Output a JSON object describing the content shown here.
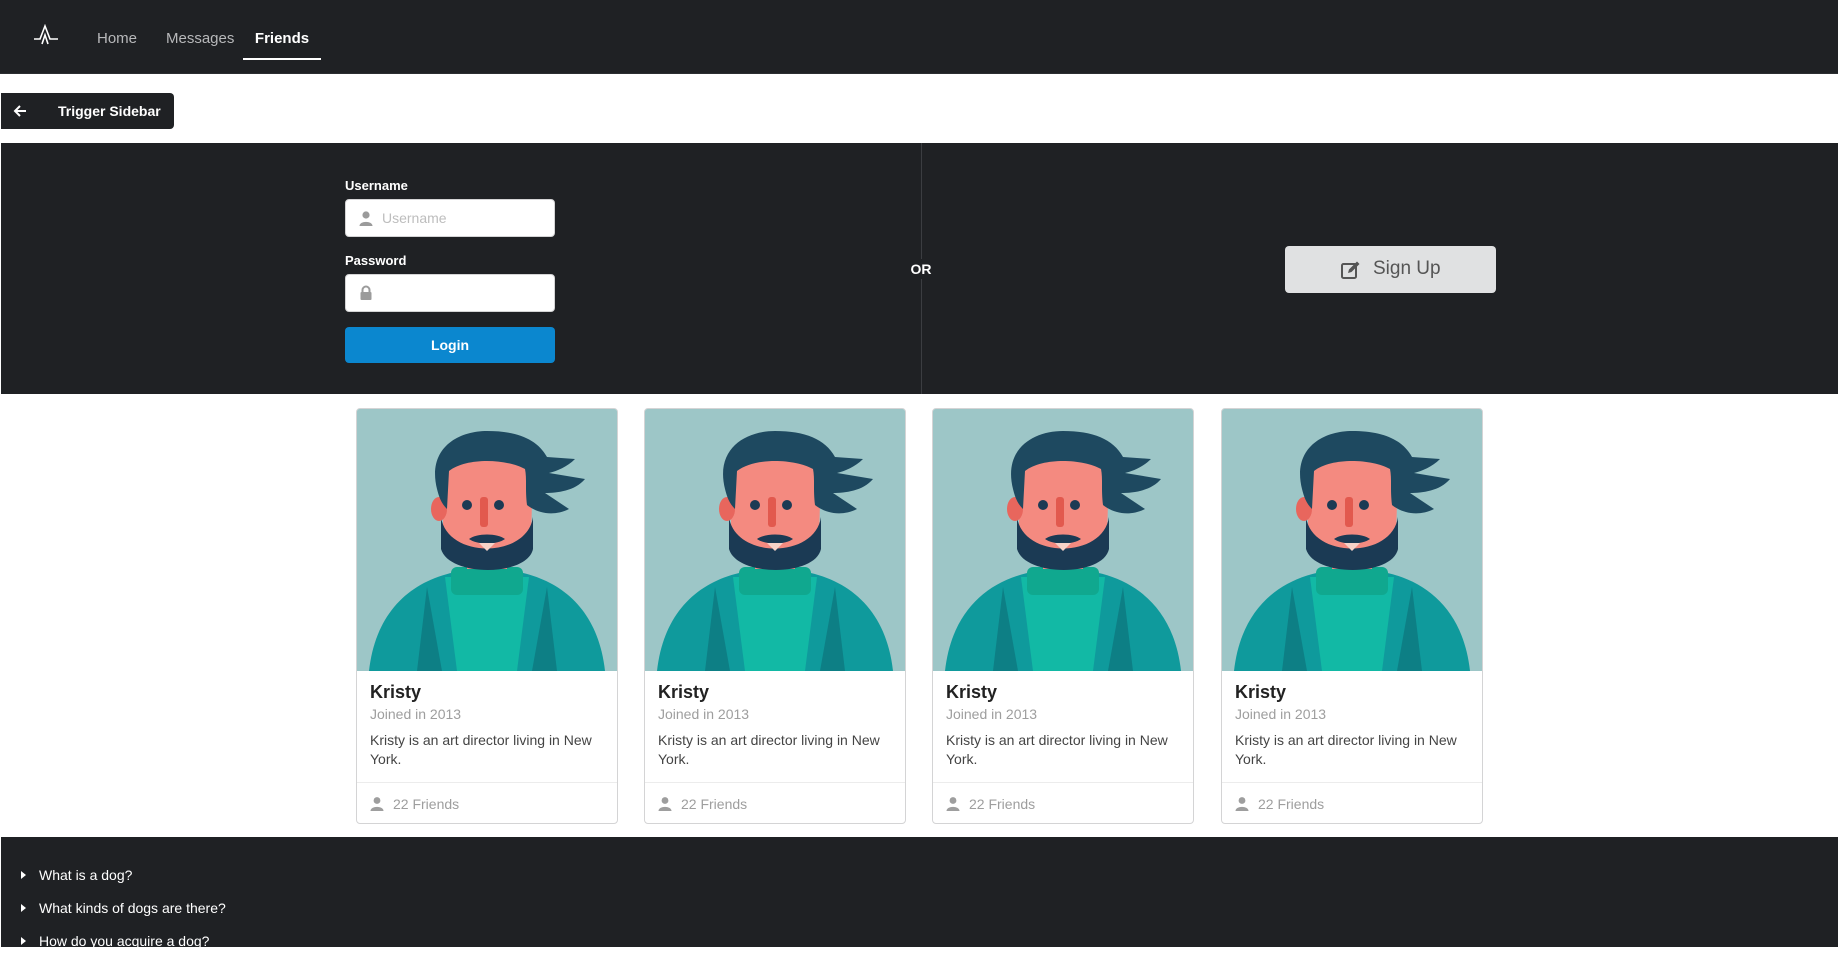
{
  "nav": {
    "logo_icon": "logo-icon",
    "items": [
      {
        "label": "Home"
      },
      {
        "label": "Messages"
      },
      {
        "label": "Friends",
        "active": true
      }
    ]
  },
  "sidebar_trigger": {
    "label": "Trigger Sidebar",
    "icon": "arrow-left-icon"
  },
  "login": {
    "username_label": "Username",
    "username_placeholder": "Username",
    "username_value": "",
    "password_label": "Password",
    "password_value": "",
    "login_button": "Login",
    "or_text": "OR",
    "signup_button": "Sign Up",
    "accent_color": "#0b87cf"
  },
  "cards": [
    {
      "name": "Kristy",
      "meta": "Joined in 2013",
      "description": "Kristy is an art director living in New York.",
      "friends": "22 Friends"
    },
    {
      "name": "Kristy",
      "meta": "Joined in 2013",
      "description": "Kristy is an art director living in New York.",
      "friends": "22 Friends"
    },
    {
      "name": "Kristy",
      "meta": "Joined in 2013",
      "description": "Kristy is an art director living in New York.",
      "friends": "22 Friends"
    },
    {
      "name": "Kristy",
      "meta": "Joined in 2013",
      "description": "Kristy is an art director living in New York.",
      "friends": "22 Friends"
    }
  ],
  "accordion": [
    {
      "title": "What is a dog?"
    },
    {
      "title": "What kinds of dogs are there?"
    },
    {
      "title": "How do you acquire a dog?"
    }
  ]
}
